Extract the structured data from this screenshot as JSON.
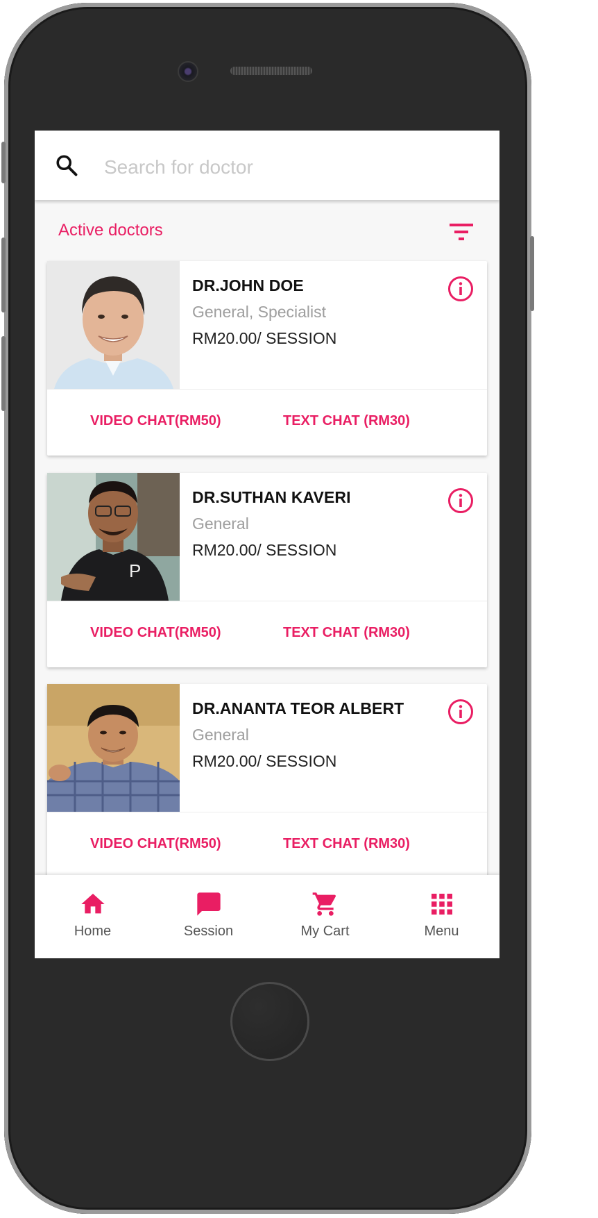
{
  "search": {
    "placeholder": "Search for doctor"
  },
  "section": {
    "title": "Active doctors"
  },
  "doctors": [
    {
      "name": "DR.JOHN DOE",
      "specialty": "General, Specialist",
      "price": "RM20.00/ SESSION",
      "video_label": "VIDEO CHAT(RM50)",
      "text_label": "TEXT CHAT (RM30)"
    },
    {
      "name": "DR.SUTHAN KAVERI",
      "specialty": "General",
      "price": "RM20.00/ SESSION",
      "video_label": "VIDEO CHAT(RM50)",
      "text_label": "TEXT CHAT (RM30)"
    },
    {
      "name": "DR.ANANTA TEOR ALBERT",
      "specialty": "General",
      "price": "RM20.00/ SESSION",
      "video_label": "VIDEO CHAT(RM50)",
      "text_label": "TEXT CHAT (RM30)"
    }
  ],
  "nav": [
    {
      "label": "Home",
      "icon": "home-icon"
    },
    {
      "label": "Session",
      "icon": "chat-bubble-icon"
    },
    {
      "label": "My Cart",
      "icon": "cart-icon"
    },
    {
      "label": "Menu",
      "icon": "grid-menu-icon"
    }
  ],
  "colors": {
    "accent": "#e91e63",
    "muted_text": "#9e9e9e"
  }
}
